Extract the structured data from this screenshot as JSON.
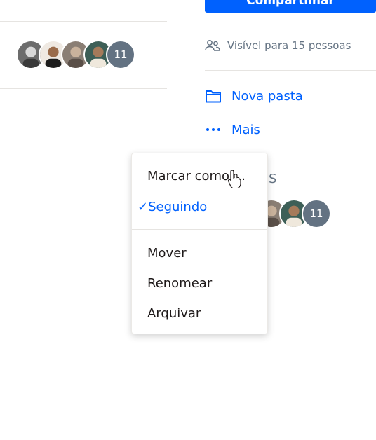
{
  "share_button": {
    "label": "Compartilhar"
  },
  "visibility": {
    "text": "Visível para 15 pessoas",
    "icon": "people-icon"
  },
  "actions": [
    {
      "label": "Nova pasta",
      "icon": "folder-icon"
    },
    {
      "label": "Mais",
      "icon": "more-dots-icon"
    }
  ],
  "avatars_top": {
    "count_label": "11"
  },
  "avatars_bottom": {
    "count_label": "11"
  },
  "partially_hidden_text": "S",
  "context_menu": {
    "mark_as": "Marcar como ...",
    "following": {
      "check": "✓",
      "label": "Seguindo"
    },
    "move": "Mover",
    "rename": "Renomear",
    "archive": "Arquivar"
  },
  "colors": {
    "accent": "#0061fe",
    "muted": "#637282",
    "divider": "#e6e4e1"
  }
}
